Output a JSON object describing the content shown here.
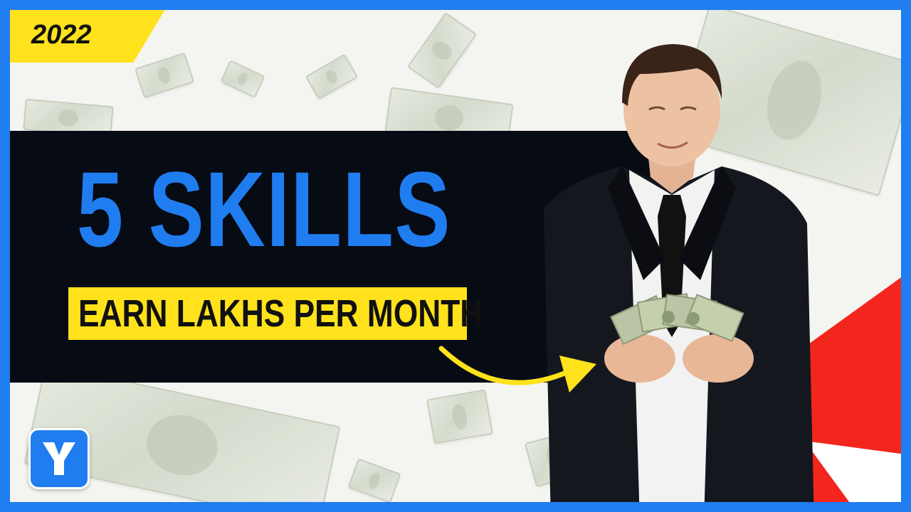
{
  "badge": {
    "year": "2022"
  },
  "headline": {
    "title": "5 SKILLS",
    "subtitle": "EARN LAKHS PER MONTH"
  },
  "colors": {
    "frame": "#1f7df0",
    "accent_yellow": "#ffe21c",
    "panel": "#070b14",
    "headline_blue": "#1f7df0",
    "corner_red": "#f3261d"
  },
  "icons": {
    "arrow": "curved-arrow-icon",
    "logo": "y-logo-icon",
    "decor": "dollar-bill-icon"
  }
}
